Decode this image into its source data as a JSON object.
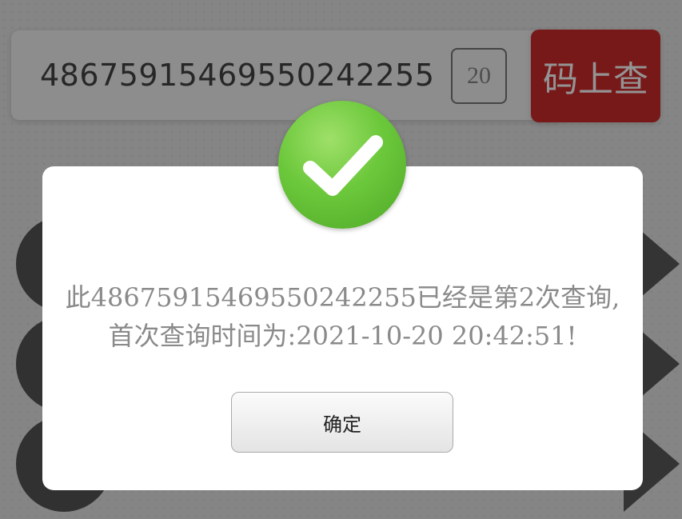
{
  "search": {
    "code": "4867591546955024225​5",
    "count": "20",
    "button_label": "码上查"
  },
  "dialog": {
    "message_line1": "此4867591546955024225​5已经是第2次查询,",
    "message_line2": "首次查询时间为:2021-10-20 20:42:51!",
    "confirm_label": "确定",
    "icon": "checkmark-icon"
  },
  "colors": {
    "accent_red": "#cf2b2b",
    "success_green": "#6cc83b"
  }
}
